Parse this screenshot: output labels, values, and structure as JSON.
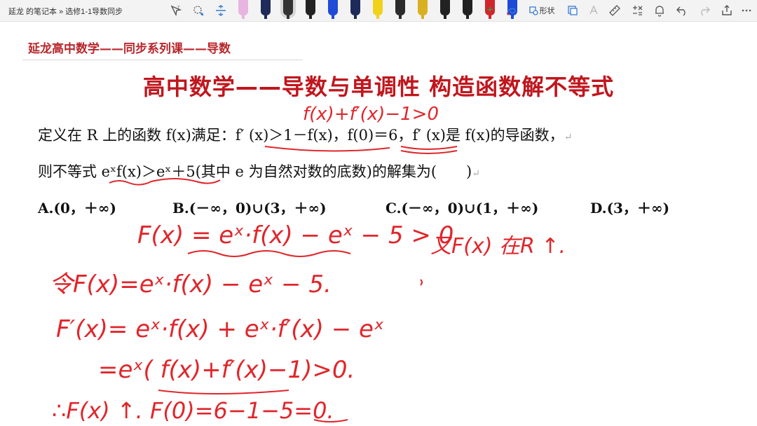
{
  "breadcrumb": "延龙 的笔记本 » 选修1-1导数同步",
  "toolbar": {
    "shape_label": "形状"
  },
  "colors": {
    "header_red": "#b8262b",
    "title_red": "#c0161d",
    "ink_red": "#e0262b"
  },
  "pens": [
    "#e8b4e0",
    "#1d2a5a",
    "#333333",
    "#222222",
    "#1f4ad8",
    "#1d2a5a",
    "#f0d21a",
    "#2b2b2b",
    "#d8b020",
    "#222222",
    "#222222",
    "#d1252b",
    "#1f4ad8"
  ],
  "page": {
    "header": "延龙高中数学——同步系列课——导数",
    "title": "高中数学——导数与单调性 构造函数解不等式",
    "question_line1": "定义在 R 上的函数 f(x)满足：f′ (x)＞1－f(x)，f(0)＝6，f′ (x)是 f(x)的导函数，",
    "question_line2": "则不等式 eˣf(x)＞eˣ＋5(其中 e 为自然对数的底数)的解集为(　　)",
    "options": {
      "a": "A.(0，＋∞)",
      "b": "B.(－∞，0)∪(3，＋∞)",
      "c": "C.(－∞，0)∪(1，＋∞)",
      "d": "D.(3，＋∞)"
    },
    "paragraph_mark": "↵"
  },
  "handwriting": {
    "above_q1": "f(x)+f′(x)−1>0",
    "line1": "F(x) = eˣ·f(x) − eˣ − 5 > 0",
    "side_note": "又F(x) 在R ↑.",
    "line2": "令F(x)=eˣ·f(x) − eˣ − 5.",
    "line3": "F′(x)= eˣ·f(x) + eˣ·f′(x) − eˣ",
    "line4": "=eˣ( f(x)+f′(x)−1)>0.",
    "line5": "∴F(x) ↑.  F(0)=6−1−5=0."
  }
}
